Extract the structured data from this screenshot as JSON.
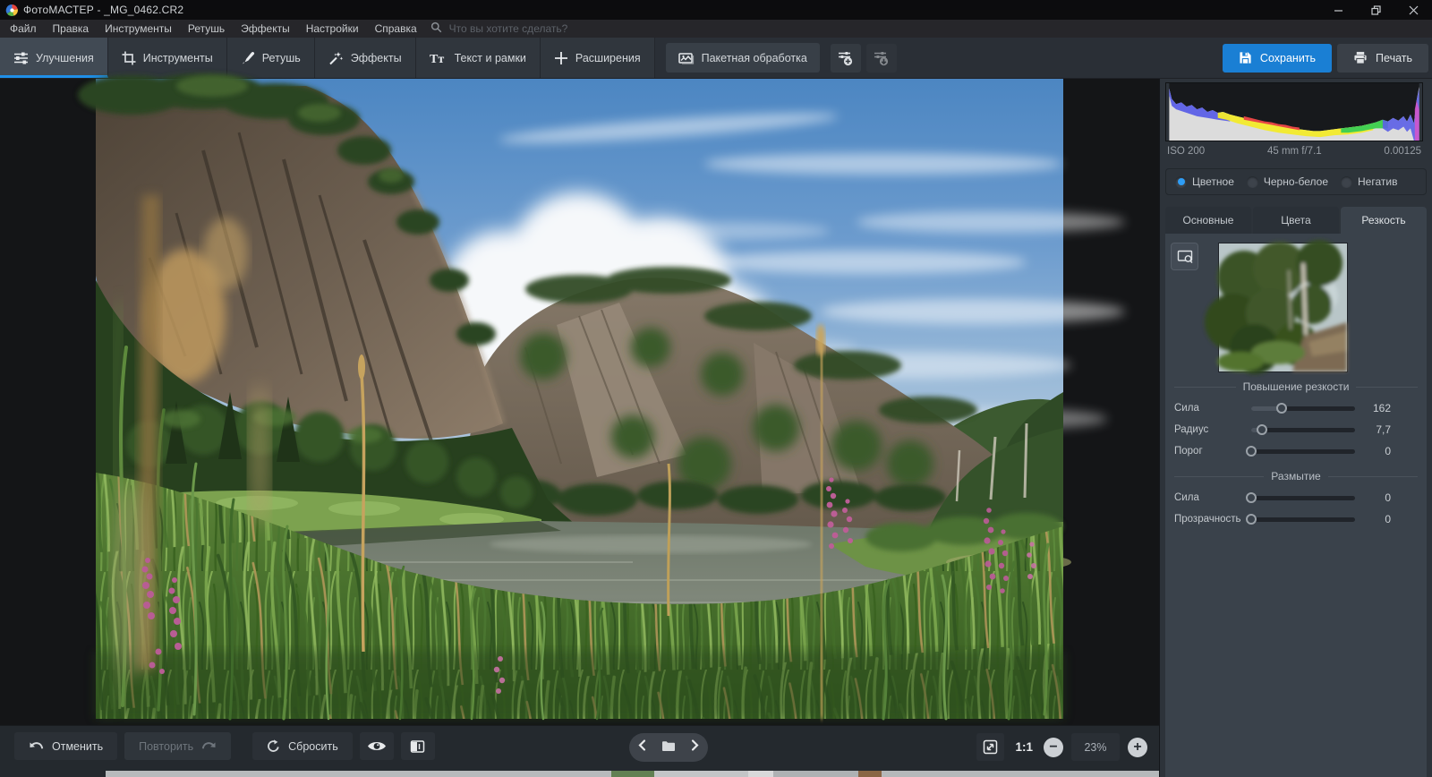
{
  "window": {
    "title": "ФотоМАСТЕР - _MG_0462.CR2"
  },
  "menu": {
    "items": [
      "Файл",
      "Правка",
      "Инструменты",
      "Ретушь",
      "Эффекты",
      "Настройки",
      "Справка"
    ],
    "search_placeholder": "Что вы хотите сделать?"
  },
  "toolbar": {
    "tabs": [
      {
        "label": "Улучшения",
        "active": true
      },
      {
        "label": "Инструменты",
        "active": false
      },
      {
        "label": "Ретушь",
        "active": false
      },
      {
        "label": "Эффекты",
        "active": false
      },
      {
        "label": "Текст и рамки",
        "active": false
      },
      {
        "label": "Расширения",
        "active": false
      },
      {
        "label": "Пакетная обработка",
        "active": false
      }
    ],
    "save_label": "Сохранить",
    "print_label": "Печать"
  },
  "panel": {
    "exif": {
      "iso": "ISO 200",
      "lens": "45 mm f/7.1",
      "exposure": "0.00125"
    },
    "modes": [
      {
        "label": "Цветное",
        "selected": true
      },
      {
        "label": "Черно-белое",
        "selected": false
      },
      {
        "label": "Негатив",
        "selected": false
      }
    ],
    "tabs": [
      {
        "label": "Основные",
        "active": false
      },
      {
        "label": "Цвета",
        "active": false
      },
      {
        "label": "Резкость",
        "active": true
      }
    ],
    "sharpen": {
      "title": "Повышение резкости",
      "sliders": [
        {
          "label": "Сила",
          "value": "162",
          "percent": 29
        },
        {
          "label": "Радиус",
          "value": "7,7",
          "percent": 10
        },
        {
          "label": "Порог",
          "value": "0",
          "percent": 0
        }
      ]
    },
    "blur": {
      "title": "Размытие",
      "sliders": [
        {
          "label": "Сила",
          "value": "0",
          "percent": 0
        },
        {
          "label": "Прозрачность",
          "value": "0",
          "percent": 0
        }
      ]
    }
  },
  "bottom": {
    "undo": "Отменить",
    "redo": "Повторить",
    "reset": "Сбросить",
    "ratio": "1:1",
    "zoom": "23%"
  },
  "colors": {
    "accent": "#1f8fe8",
    "save_button": "#1a7fd4",
    "radio_selected": "#2e9df5"
  }
}
